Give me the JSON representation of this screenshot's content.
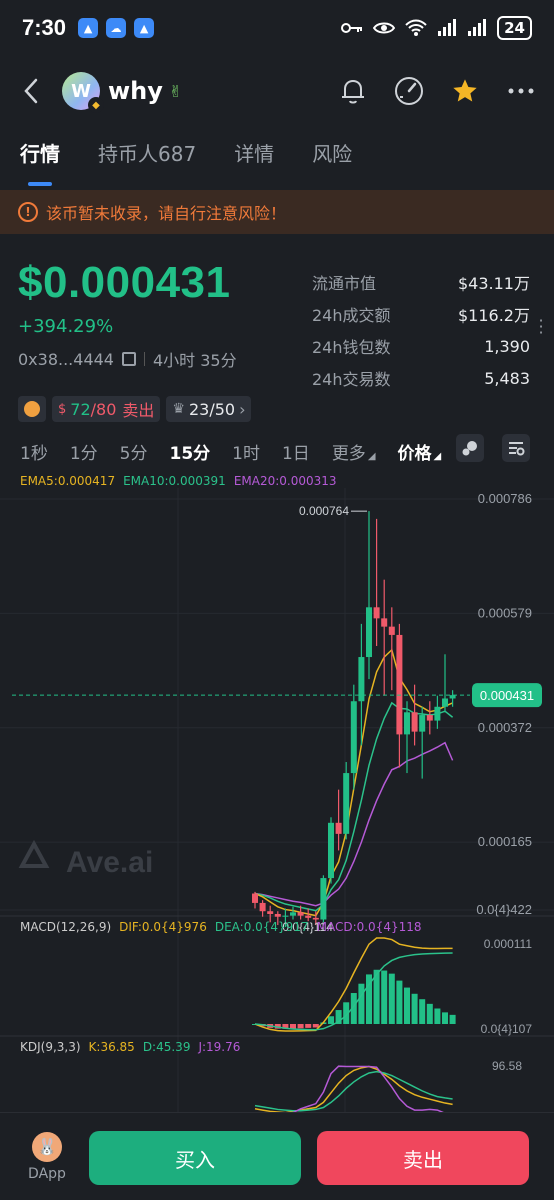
{
  "status": {
    "time": "7:30",
    "battery": "24"
  },
  "header": {
    "avatar_letter": "W",
    "token_name": "why",
    "token_emoji": "✌"
  },
  "tabs": [
    {
      "label": "行情"
    },
    {
      "label": "持币人687"
    },
    {
      "label": "详情"
    },
    {
      "label": "风险"
    }
  ],
  "warning": {
    "icon": "!",
    "text": "该币暂未收录，请自行注意风险！"
  },
  "price": {
    "value": "$0.000431",
    "change": "+394.29%",
    "address": "0x38...4444",
    "age": "4小时 35分"
  },
  "stats": [
    {
      "label": "流通市值",
      "value": "$43.11万"
    },
    {
      "label": "24h成交额",
      "value": "$116.2万"
    },
    {
      "label": "24h钱包数",
      "value": "1,390"
    },
    {
      "label": "24h交易数",
      "value": "5,483"
    }
  ],
  "tags": {
    "buy_count": "72",
    "sell_count": "/80",
    "sell_label": "卖出",
    "holders": "23/50"
  },
  "intervals": [
    {
      "label": "1秒"
    },
    {
      "label": "1分"
    },
    {
      "label": "5分"
    },
    {
      "label": "15分",
      "active": true
    },
    {
      "label": "1时"
    },
    {
      "label": "1日"
    },
    {
      "label": "更多"
    },
    {
      "label": "价格"
    }
  ],
  "colors": {
    "up": "#22c088",
    "down": "#f05a6a",
    "ema5": "#e6b422",
    "ema10": "#2bc28b",
    "ema20": "#b55ad6",
    "accent": "#3d8af7"
  },
  "ema_legend": {
    "ema5": "EMA5:0.000417",
    "ema10": "EMA10:0.000391",
    "ema20": "EMA20:0.000313"
  },
  "macd_legend": {
    "title": "MACD(12,26,9)",
    "dif": "DIF:0.0{4}976",
    "dea": "DEA:0.0{4}917",
    "macd": "MACD:0.0{4}118"
  },
  "kdj_legend": {
    "title": "KDJ(9,3,3)",
    "k": "K:36.85",
    "d": "D:45.39",
    "j": "J:19.76"
  },
  "chart_data": {
    "type": "candlestick",
    "title": "",
    "y_ticks": [
      "0.000786",
      "0.000579",
      "0.000372",
      "0.000165",
      "0.0{4}422"
    ],
    "y_tick_values": [
      0.000786,
      0.000579,
      0.000372,
      0.000165,
      4.22e-05
    ],
    "current_price_label": "0.000431",
    "current_price": 0.000431,
    "high_label": "0.000764",
    "high_value": 0.000764,
    "low_label": "0.0{4}114",
    "low_value": 1.14e-05,
    "macd_tick_top": "0.000111",
    "macd_tick_bottom": "0.0{4}107",
    "kdj_tick_top": "96.58",
    "ylim": [
      4.22e-05,
      0.000786
    ],
    "candles": [
      {
        "o": 7.2e-05,
        "h": 7.5e-05,
        "l": 4.5e-05,
        "c": 5.5e-05
      },
      {
        "o": 5.5e-05,
        "h": 6e-05,
        "l": 3e-05,
        "c": 4e-05
      },
      {
        "o": 4e-05,
        "h": 5e-05,
        "l": 2e-05,
        "c": 3.5e-05
      },
      {
        "o": 3.5e-05,
        "h": 4e-05,
        "l": 1.5e-05,
        "c": 3e-05
      },
      {
        "o": 3e-05,
        "h": 4.5e-05,
        "l": 1.14e-05,
        "c": 3.2e-05
      },
      {
        "o": 3.2e-05,
        "h": 4.8e-05,
        "l": 2.5e-05,
        "c": 3.8e-05
      },
      {
        "o": 3.8e-05,
        "h": 5e-05,
        "l": 2.5e-05,
        "c": 3.2e-05
      },
      {
        "o": 3.2e-05,
        "h": 4.5e-05,
        "l": 2.2e-05,
        "c": 2.8e-05
      },
      {
        "o": 2.8e-05,
        "h": 4e-05,
        "l": 1.5e-05,
        "c": 2.5e-05
      },
      {
        "o": 2.5e-05,
        "h": 0.000105,
        "l": 2e-05,
        "c": 0.0001
      },
      {
        "o": 0.0001,
        "h": 0.00021,
        "l": 9e-05,
        "c": 0.0002
      },
      {
        "o": 0.0002,
        "h": 0.00026,
        "l": 0.00015,
        "c": 0.00018
      },
      {
        "o": 0.00018,
        "h": 0.00031,
        "l": 0.00017,
        "c": 0.00029
      },
      {
        "o": 0.00029,
        "h": 0.00045,
        "l": 0.00026,
        "c": 0.00042
      },
      {
        "o": 0.00042,
        "h": 0.00056,
        "l": 0.00034,
        "c": 0.0005
      },
      {
        "o": 0.0005,
        "h": 0.000764,
        "l": 0.00046,
        "c": 0.00059
      },
      {
        "o": 0.00059,
        "h": 0.00075,
        "l": 0.00052,
        "c": 0.00057
      },
      {
        "o": 0.00057,
        "h": 0.00064,
        "l": 0.00043,
        "c": 0.000555
      },
      {
        "o": 0.000555,
        "h": 0.00059,
        "l": 0.00044,
        "c": 0.00054
      },
      {
        "o": 0.00054,
        "h": 0.00056,
        "l": 0.0003,
        "c": 0.00036
      },
      {
        "o": 0.00036,
        "h": 0.00042,
        "l": 0.00029,
        "c": 0.0004
      },
      {
        "o": 0.0004,
        "h": 0.00045,
        "l": 0.00034,
        "c": 0.000365
      },
      {
        "o": 0.000365,
        "h": 0.00041,
        "l": 0.00028,
        "c": 0.000395
      },
      {
        "o": 0.000395,
        "h": 0.00042,
        "l": 0.00036,
        "c": 0.000385
      },
      {
        "o": 0.000385,
        "h": 0.00043,
        "l": 0.00037,
        "c": 0.00041
      },
      {
        "o": 0.00041,
        "h": 0.000505,
        "l": 0.0004,
        "c": 0.000425
      },
      {
        "o": 0.000425,
        "h": 0.00044,
        "l": 0.00041,
        "c": 0.000431
      }
    ],
    "ema5": [
      7.2e-05,
      6.6e-05,
      5.7e-05,
      4.8e-05,
      4.3e-05,
      4.1e-05,
      3.8e-05,
      3.5e-05,
      3.2e-05,
      5.5e-05,
      0.000103,
      0.000129,
      0.000183,
      0.000262,
      0.000341,
      0.000424,
      0.000473,
      0.0005,
      0.000513,
      0.000462,
      0.000441,
      0.000416,
      0.000409,
      0.000401,
      0.000404,
      0.000411,
      0.000417
    ],
    "ema10": [
      7.2e-05,
      6.9e-05,
      6.4e-05,
      5.8e-05,
      5.3e-05,
      5e-05,
      4.7e-05,
      4.4e-05,
      4.1e-05,
      5.2e-05,
      7.9e-05,
      9.7e-05,
      0.000132,
      0.000184,
      0.000241,
      0.000304,
      0.000352,
      0.000389,
      0.000417,
      0.000407,
      0.000406,
      0.000398,
      0.000397,
      0.000395,
      0.000397,
      0.000402,
      0.000391
    ],
    "ema20": [
      7.2e-05,
      7e-05,
      6.7e-05,
      6.4e-05,
      6.1e-05,
      5.8e-05,
      5.6e-05,
      5.3e-05,
      5e-05,
      5.5e-05,
      6.9e-05,
      8e-05,
      0.0001,
      0.00013,
      0.000165,
      0.000205,
      0.00024,
      0.00027,
      0.000296,
      0.000302,
      0.000312,
      0.000317,
      0.000324,
      0.00033,
      0.000337,
      0.000345,
      0.000313
    ],
    "macd_hist": [
      0.0,
      -3e-06,
      -5e-06,
      -6e-06,
      -6.2e-06,
      -6e-06,
      -5.5e-06,
      -5e-06,
      -4.5e-06,
      2e-06,
      1e-05,
      1.8e-05,
      2.8e-05,
      4e-05,
      5.2e-05,
      6.4e-05,
      7e-05,
      6.9e-05,
      6.5e-05,
      5.6e-05,
      4.7e-05,
      3.9e-05,
      3.2e-05,
      2.6e-05,
      2e-05,
      1.5e-05,
      1.18e-05
    ],
    "macd_dif": [
      0.0,
      -4e-06,
      -7e-06,
      -8.5e-06,
      -9e-06,
      -9e-06,
      -8.8e-06,
      -8.5e-06,
      -8.2e-06,
      2e-06,
      1.5e-05,
      2.9e-05,
      4.6e-05,
      6.6e-05,
      8.5e-05,
      0.000103,
      0.000111,
      0.000111,
      0.000109,
      0.000103,
      0.000101,
      9.9e-05,
      9.8e-05,
      9.75e-05,
      9.75e-05,
      9.76e-05,
      9.76e-05
    ],
    "macd_dea": [
      0.0,
      -1e-06,
      -2.5e-06,
      -4e-06,
      -5.5e-06,
      -6.5e-06,
      -7e-06,
      -7.3e-06,
      -7.5e-06,
      -6e-06,
      -2e-06,
      3e-06,
      1.1e-05,
      2.3e-05,
      3.7e-05,
      5.1e-05,
      6.4e-05,
      7.5e-05,
      8.2e-05,
      8.6e-05,
      8.8e-05,
      8.95e-05,
      9.03e-05,
      9.08e-05,
      9.12e-05,
      9.15e-05,
      9.17e-05
    ],
    "kdj_k": [
      30,
      28,
      26,
      25,
      24,
      26,
      28,
      30,
      32,
      40,
      55,
      70,
      82,
      90,
      94,
      96,
      92,
      84,
      76,
      66,
      58,
      52,
      48,
      45,
      42,
      39,
      36.85
    ],
    "kdj_d": [
      35,
      33,
      31,
      29,
      28,
      27,
      27,
      28,
      29,
      32,
      40,
      50,
      62,
      72,
      80,
      86,
      88,
      86,
      82,
      76,
      70,
      64,
      58,
      53,
      49,
      47,
      45.39
    ],
    "kdj_j": [
      20,
      18,
      16,
      17,
      16,
      24,
      30,
      34,
      38,
      56,
      85,
      96.58,
      96,
      96,
      96,
      96,
      95,
      80,
      64,
      46,
      34,
      28,
      28,
      29,
      28,
      23,
      19.76
    ]
  },
  "bottom": {
    "dapp_label": "DApp",
    "buy_label": "买入",
    "sell_label": "卖出"
  }
}
